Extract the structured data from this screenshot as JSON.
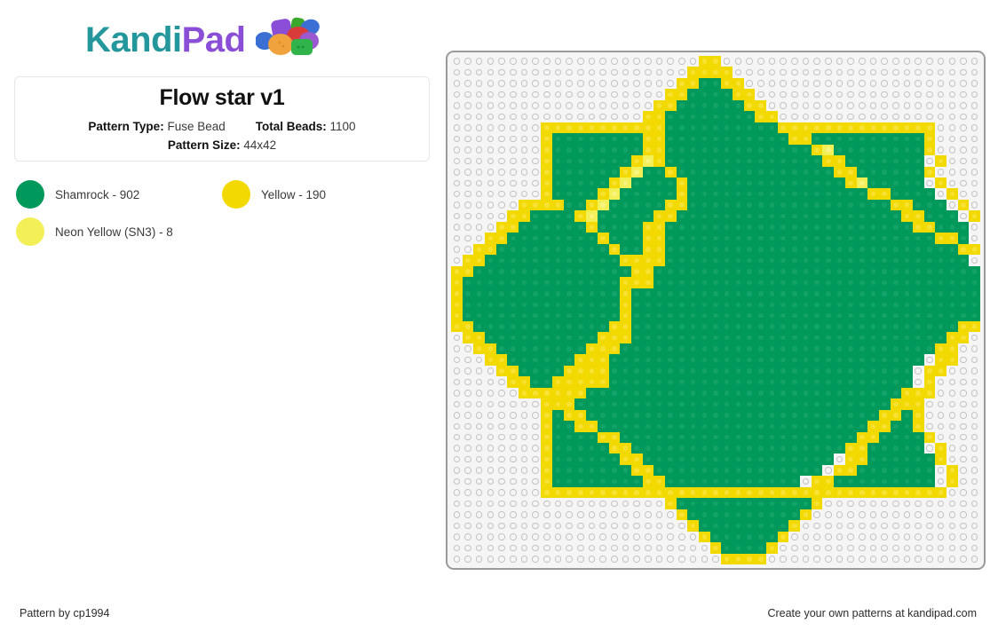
{
  "brand": {
    "name_part1": "Kandi",
    "name_part2": "Pad",
    "color_part1": "#23979b",
    "color_part2": "#8a4fd6",
    "bead_colors": [
      "#8a4fd6",
      "#3aa82c",
      "#3b6fd4",
      "#d93b3b",
      "#f0a33c",
      "#9b59d0",
      "#2fb34a"
    ]
  },
  "info": {
    "title": "Flow star v1",
    "pattern_type_label": "Pattern Type:",
    "pattern_type_value": "Fuse Bead",
    "total_beads_label": "Total Beads:",
    "total_beads_value": "1100",
    "pattern_size_label": "Pattern Size:",
    "pattern_size_value": "44x42"
  },
  "legend": {
    "items": [
      {
        "label": "Shamrock - 902",
        "color": "#00995c",
        "code": "g"
      },
      {
        "label": "Yellow - 190",
        "color": "#f2d900",
        "code": "y"
      },
      {
        "label": "Neon Yellow (SN3) - 8",
        "color": "#f2ef57",
        "code": "n"
      }
    ]
  },
  "board": {
    "cols": 47,
    "rows": 46,
    "empty_peg_color": "#f5f5f5",
    "peg_ring_color": "#c2c2c2",
    "border_color": "#9a9a9a",
    "palette": {
      "e": "transparent",
      "g": "#00995c",
      "y": "#f2d900",
      "n": "#f2ef57"
    },
    "grid": [
      "eeeeeeeeeeeeeeeeeeeeeeyyeeeeeeeeeeeeeeeeeeeeeee",
      "eeeeeeeeeeeeeeeeeeeeeyyyyeeeeeeeeeeeeeeeeeeeeee",
      "eeeeeeeeeeeeeeeeeeeeyyggyyeeeeeeeeeeeeeeeeeeeee",
      "eeeeeeeeeeeeeeeeeeeyyggggyyeeeeeeeeeeeeeeeeeeee",
      "eeeeeeeeeeeeeeeeeeyyggggggyyeeeeeeeeeeeeeeeeeee",
      "eeeeeeeeeeeeeeeeeyyggggggggyyeeeeeeeeeeeeeeeeee",
      "eeeeeeeeyyyyyyyyyyyggggggggggyyyyyyyyyyyyyyeeee",
      "eeeeeeeeyggggggggyygggggggggggyyggggggggggyeeee",
      "eeeeeeeeyggggggggyygggggggggggggynggggggggyeeee",
      "eeeeeeeeygggggggynyggggggggggggggyyggggggg yeee",
      "eeeeeeeeyggggggynggyggggggggggggggyyggggggyeeee",
      "eeeeeeeeygggggynggggyggggggggggggggynggggg yeee",
      "eeeeeeeeyggggyngggggyggggggggggggggggyygggg yee",
      "eeeeeeyyyyggyngggggyyggggggggggggggggggyyggg ye",
      "eeeeeyyggggyngggggyyggggggggggggggggggggyyggg y",
      "eeeeyyggggggyggggyyggggggggggggggggggggggyyggg ",
      "eeeyyggggggggygggyyggggggggggggggggggggggggyyg ",
      "eeyyggggggggggyggyyggggggggggggggggggggggggggyy",
      "eyyggggggggggggyyyyggggggggggggggggggggggggggg ",
      "yyggggggggggggggyyggggggggggggggggggggggggggggg",
      "yggggggggggggggyyyggggggggggggggggggggggggggggg",
      "yggggggggggggggyggggggggggggggggggggggggggggggg",
      "yggggggggggggggyggggggggggggggggggggggggggggggg",
      "yggggggggggggggyggggggggggggggggggggggggggggggg",
      "yyggggggggggggyygggggggggggggggggggggggggggggyy",
      "eyyggggggggggyyyggggggggggggggggggggggggggggyye",
      "eeyyggggggggyyyggggggggggggggggggggggggggggyyee",
      "eeeyyggggggyyygggggggggggggggggggggggggggg yyee",
      "eeeeyyggggyyyyggggggggggggggggggggggggggg yyeee",
      "eeeeeyyggyyyyyggggggggggggggggggggggggggg yeeee",
      "eeeeeeyyyyyyggggggggggggggggggggggggggggyyyeeee",
      "eeeeeeeeyyyggggggggggggggggggggggggggggyyyeeeee",
      "eeeeeeeeygyyggggggggggggggggggggggggggyygyeeeee",
      "eeeeeeeeyggyyggggggggggggggggggggggggyyggyeeeee",
      "eeeeeeeeyggggyygggggggggggggggggggggyyggggyeeee",
      "eeeeeeeeygggggyygggggggggggggggggggyyggggg yeee",
      "eeeeeeeeyggggggyyggggggggggggggggg yyggggggyeee",
      "eeeeeeeeygggggggyyggggggggggggggg yyggggggg yee",
      "eeeeeeeeyggggggggyygggggggggggg yyggggggggg yee",
      "eeeeeeeeyyyyyyyyyyyyyyyyyyyyyyyyyyyyyyyyyyyyeee",
      "eeeeeeeeeeeeeeeeeeeyggggggggggggyeeeeeeeeeeeeee",
      "eeeeeeeeeeeeeeeeeeeeyggggggggggyeeeeeeeeeeeeeee",
      "eeeeeeeeeeeeeeeeeeeeeyggggggggyeeeeeeeeeeeeeeee",
      "eeeeeeeeeeeeeeeeeeeeeeyggggggyeeeeeeeeeeeeeeeee",
      "eeeeeeeeeeeeeeeeeeeeeeeyggggyeeeeeeeeeeeeeeeeee",
      "eeeeeeeeeeeeeeeeeeeeeeeeyyyyeeeeeeeeeeeeeeeeeee"
    ]
  },
  "footer": {
    "left_text": "Pattern by cp1994",
    "right_text": "Create your own patterns at kandipad.com"
  }
}
